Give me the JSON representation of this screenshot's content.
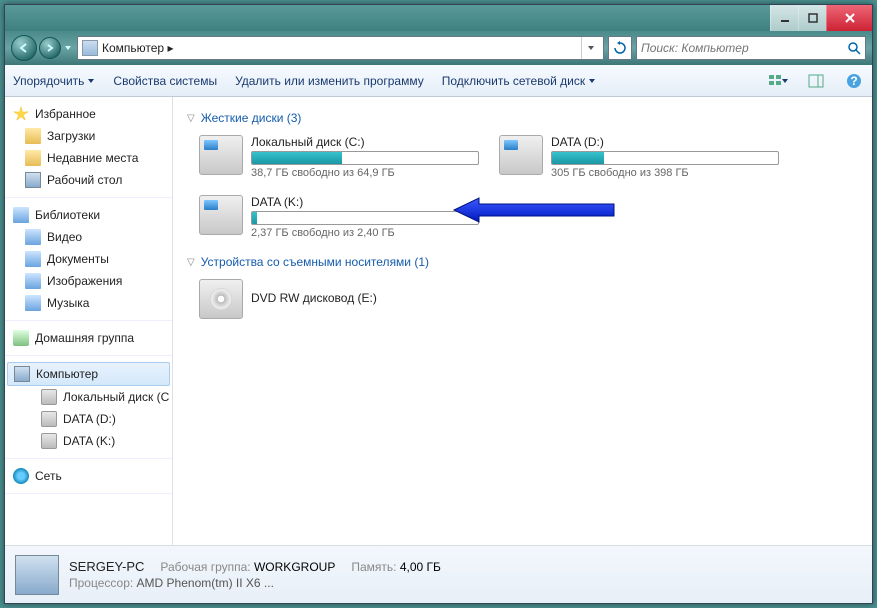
{
  "titlebar": {},
  "nav": {
    "breadcrumb": "Компьютер ▸",
    "search_placeholder": "Поиск: Компьютер"
  },
  "toolbar": {
    "organize": "Упорядочить",
    "properties": "Свойства системы",
    "uninstall": "Удалить или изменить программу",
    "mapdrive": "Подключить сетевой диск"
  },
  "sidebar": {
    "favorites": {
      "label": "Избранное",
      "items": [
        "Загрузки",
        "Недавние места",
        "Рабочий стол"
      ]
    },
    "libraries": {
      "label": "Библиотеки",
      "items": [
        "Видео",
        "Документы",
        "Изображения",
        "Музыка"
      ]
    },
    "homegroup": {
      "label": "Домашняя группа"
    },
    "computer": {
      "label": "Компьютер",
      "items": [
        "Локальный диск (C",
        "DATA (D:)",
        "DATA (K:)"
      ]
    },
    "network": {
      "label": "Сеть"
    }
  },
  "main": {
    "section_drives": "Жесткие диски (3)",
    "drives": [
      {
        "name": "Локальный диск (C:)",
        "free": "38,7 ГБ свободно из 64,9 ГБ",
        "used_pct": 40
      },
      {
        "name": "DATA (D:)",
        "free": "305 ГБ свободно из 398 ГБ",
        "used_pct": 23
      },
      {
        "name": "DATA (K:)",
        "free": "2,37 ГБ свободно из 2,40 ГБ",
        "used_pct": 2
      }
    ],
    "section_removable": "Устройства со съемными носителями (1)",
    "removable": [
      {
        "name": "DVD RW дисковод (E:)"
      }
    ]
  },
  "details": {
    "name": "SERGEY-PC",
    "workgroup_label": "Рабочая группа:",
    "workgroup": "WORKGROUP",
    "memory_label": "Память:",
    "memory": "4,00 ГБ",
    "cpu_label": "Процессор:",
    "cpu": "AMD Phenom(tm) II X6 ..."
  }
}
